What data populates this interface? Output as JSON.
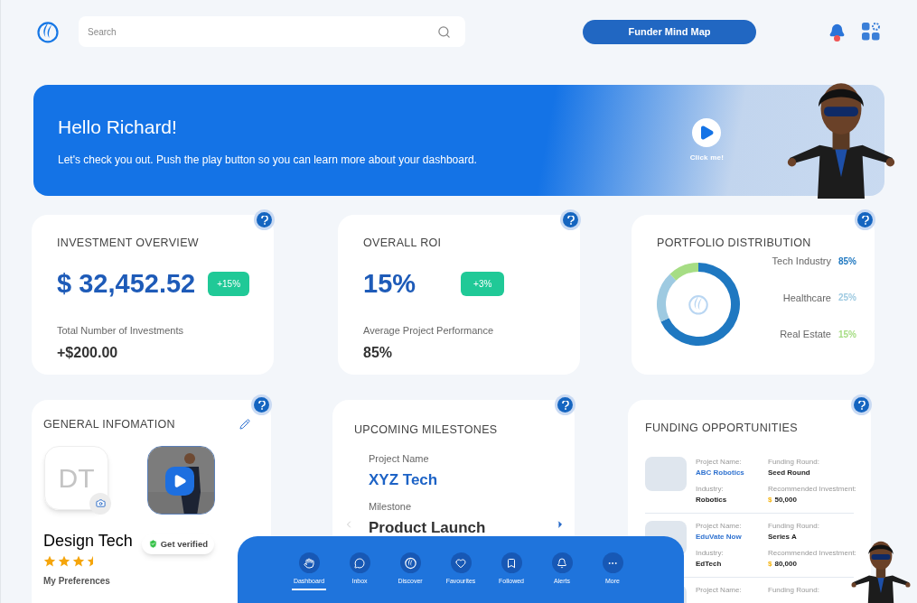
{
  "header": {
    "search": {
      "placeholder": "Search"
    },
    "mind_map_button": "Funder Mind Map",
    "notifications": {
      "unread": true
    }
  },
  "banner": {
    "title": "Hello Richard!",
    "text": "Let's check you out. Push the play button so you can learn more about your dashboard.",
    "play_label": "Click me!"
  },
  "investment_overview": {
    "title": "INVESTMENT OVERVIEW",
    "amount": "$ 32,452.52",
    "change": "+15%",
    "sub_label": "Total Number of Investments",
    "sub_value": "+$200.00"
  },
  "overall_roi": {
    "title": "OVERALL ROI",
    "value": "15%",
    "change": "+3%",
    "sub_label": "Average Project Performance",
    "sub_value": "85%"
  },
  "portfolio": {
    "title": "PORTFOLIO DISTRIBUTION",
    "legend": [
      {
        "label": "Tech Industry",
        "value": "85%",
        "color": "#1f78c1"
      },
      {
        "label": "Healthcare",
        "value": "25%",
        "color": "#9ecae1"
      },
      {
        "label": "Real Estate",
        "value": "15%",
        "color": "#a6dd84"
      }
    ]
  },
  "general_info": {
    "title": "GENERAL INFOMATION",
    "initials": "DT",
    "name": "Design Tech",
    "stars": 3.5,
    "verify": "Get verified",
    "preferences": "My Preferences"
  },
  "milestones": {
    "title": "UPCOMING MILESTONES",
    "fields": [
      {
        "label": "Project Name",
        "value": "XYZ Tech",
        "kind": "link"
      },
      {
        "label": "Milestone",
        "value": "Product Launch",
        "kind": "plain"
      }
    ]
  },
  "funding": {
    "title": "FUNDING OPPORTUNITIES",
    "rows": [
      {
        "name_label": "Project Name:",
        "name": "ABC Robotics",
        "round_label": "Funding Round:",
        "round": "Seed Round",
        "industry_label": "Industry:",
        "industry": "Robotics",
        "invest_label": "Recommended Investment:",
        "currency": "$",
        "amount": "50,000"
      },
      {
        "name_label": "Project Name:",
        "name": "EduVate Now",
        "round_label": "Funding Round:",
        "round": "Series A",
        "industry_label": "Industry:",
        "industry": "EdTech",
        "invest_label": "Recommended Investment:",
        "currency": "$",
        "amount": "80,000"
      },
      {
        "name_label": "Project Name:",
        "round_label": "Funding Round:"
      }
    ]
  },
  "nav": [
    {
      "label": "Dashboard",
      "selected": true
    },
    {
      "label": "Inbox",
      "selected": false
    },
    {
      "label": "Discover",
      "selected": false
    },
    {
      "label": "Favourites",
      "selected": false
    },
    {
      "label": "Followed",
      "selected": false
    },
    {
      "label": "Alerts",
      "selected": false
    },
    {
      "label": "More",
      "selected": false
    }
  ]
}
